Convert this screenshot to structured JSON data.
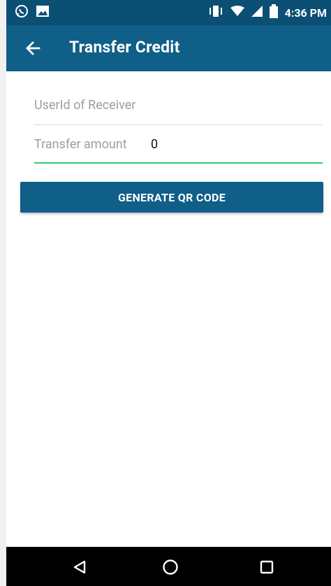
{
  "status_bar": {
    "time": "4:36 PM",
    "left_icons": [
      "whatsapp-icon",
      "image-icon"
    ],
    "right_icons": [
      "vibrate-icon",
      "wifi-icon",
      "signal-icon",
      "battery-icon"
    ]
  },
  "app_bar": {
    "title": "Transfer Credit",
    "back_icon": "arrow-left-icon"
  },
  "form": {
    "userid_placeholder": "UserId of Receiver",
    "amount_label": "Transfer amount",
    "amount_value": "0",
    "button_label": "GENERATE QR CODE"
  },
  "nav_bar": {
    "buttons": [
      "back-triangle-icon",
      "home-circle-icon",
      "recents-square-icon"
    ]
  },
  "colors": {
    "primary": "#0f5f88",
    "status": "#0b4f74",
    "accent": "#2fd06a"
  }
}
